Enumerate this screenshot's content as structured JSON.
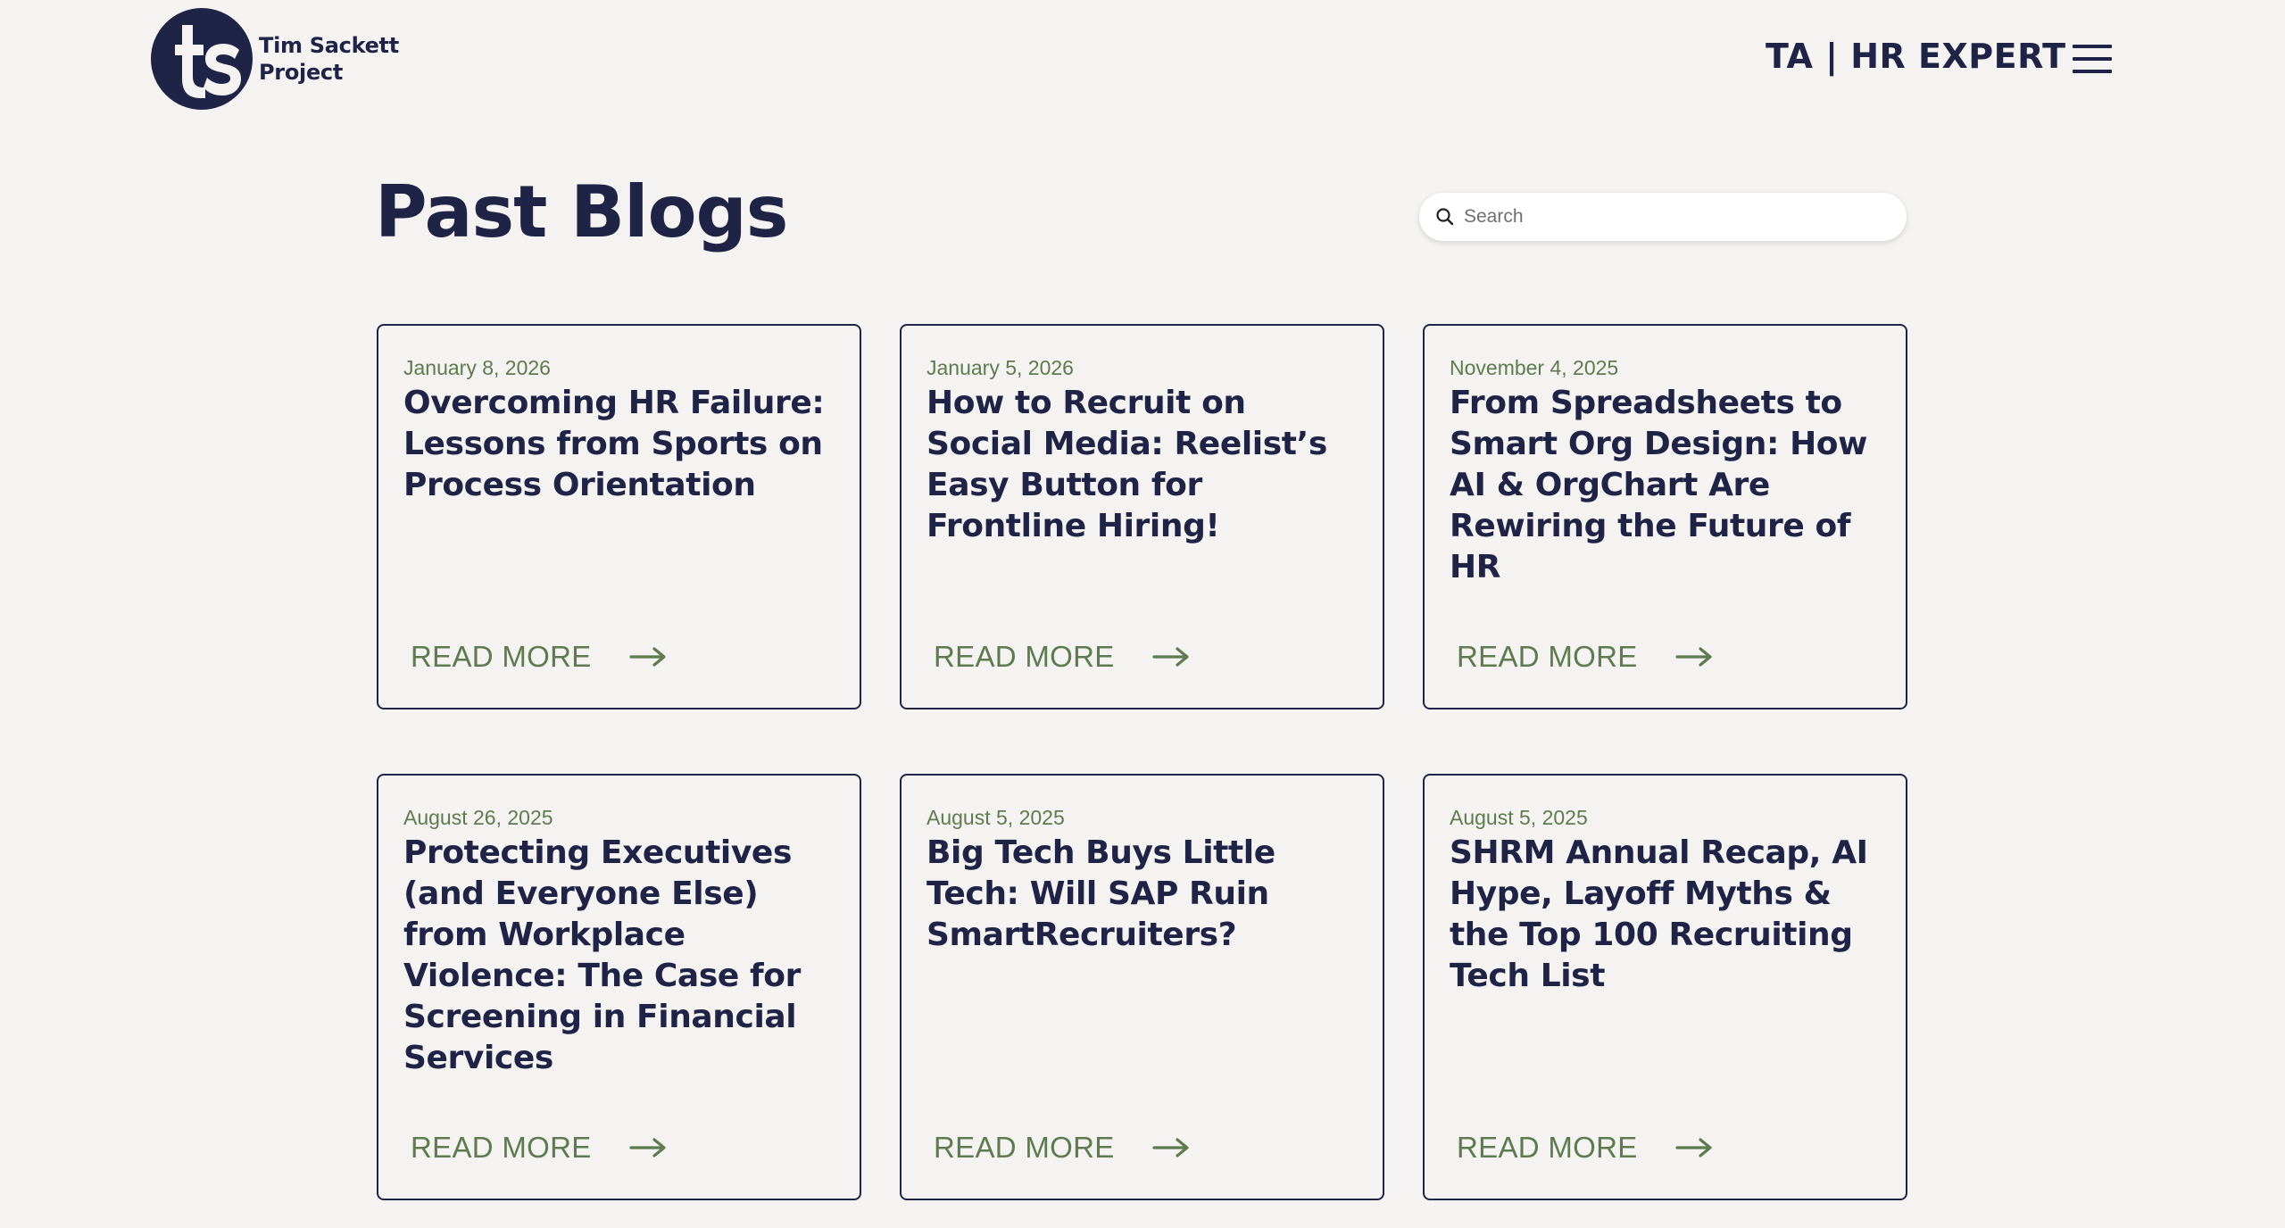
{
  "header": {
    "logo_monogram": "ts",
    "logo_line1": "Tim Sackett",
    "logo_line2": "Project",
    "nav_title": "TA | HR EXPERT",
    "menu_icon": "hamburger-menu-icon"
  },
  "main": {
    "title": "Past Blogs",
    "search": {
      "placeholder": "Search",
      "value": "",
      "icon": "search-icon"
    },
    "posts": [
      {
        "date": "January 8, 2026",
        "title": "Overcoming HR Failure: Lessons from Sports on Process Orientation",
        "read_more": "READ MORE"
      },
      {
        "date": "January 5, 2026",
        "title": "How to Recruit on Social Media: Reelist’s Easy Button for Frontline Hiring!",
        "read_more": "READ MORE"
      },
      {
        "date": "November 4, 2025",
        "title": "From Spreadsheets to Smart Org Design: How AI & OrgChart Are Rewiring the Future of HR",
        "read_more": "READ MORE"
      },
      {
        "date": "August 26, 2025",
        "title": "Protecting Executives (and Everyone Else) from Workplace Violence: The Case for Screening in Financial Services",
        "read_more": "READ MORE"
      },
      {
        "date": "August 5, 2025",
        "title": "Big Tech Buys Little Tech: Will SAP Ruin SmartRecruiters?",
        "read_more": "READ MORE"
      },
      {
        "date": "August 5, 2025",
        "title": "SHRM Annual Recap, AI Hype, Layoff Myths & the Top 100 Recruiting Tech List",
        "read_more": "READ MORE"
      }
    ]
  },
  "colors": {
    "background": "#f4f3f1",
    "navy": "#1f2447",
    "green_accent": "#5e7b50",
    "search_bg": "#ffffff"
  }
}
